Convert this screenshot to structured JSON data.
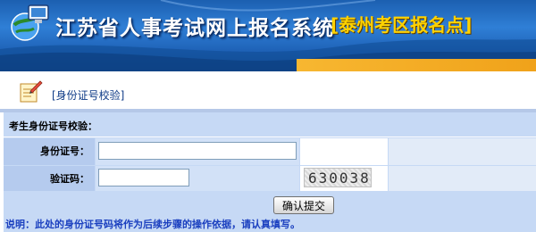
{
  "header": {
    "title": "江苏省人事考试网上报名系统",
    "subtitle": "[泰州考区报名点]"
  },
  "section": {
    "title": "[身份证号校验]"
  },
  "form": {
    "caption": "考生身份证号校验：",
    "id_label": "身份证号：",
    "id_value": "",
    "captcha_label": "验证码：",
    "captcha_value": "",
    "captcha_image_text": "630038",
    "submit_label": "确认提交"
  },
  "note": "说明：此处的身份证号码将作为后续步骤的操作依据，请认真填写。",
  "colors": {
    "banner_blue": "#1f63b8",
    "banner_accent": "#f0a21a",
    "form_bg": "#c6d9f5",
    "note_text": "#1a3fbf"
  }
}
